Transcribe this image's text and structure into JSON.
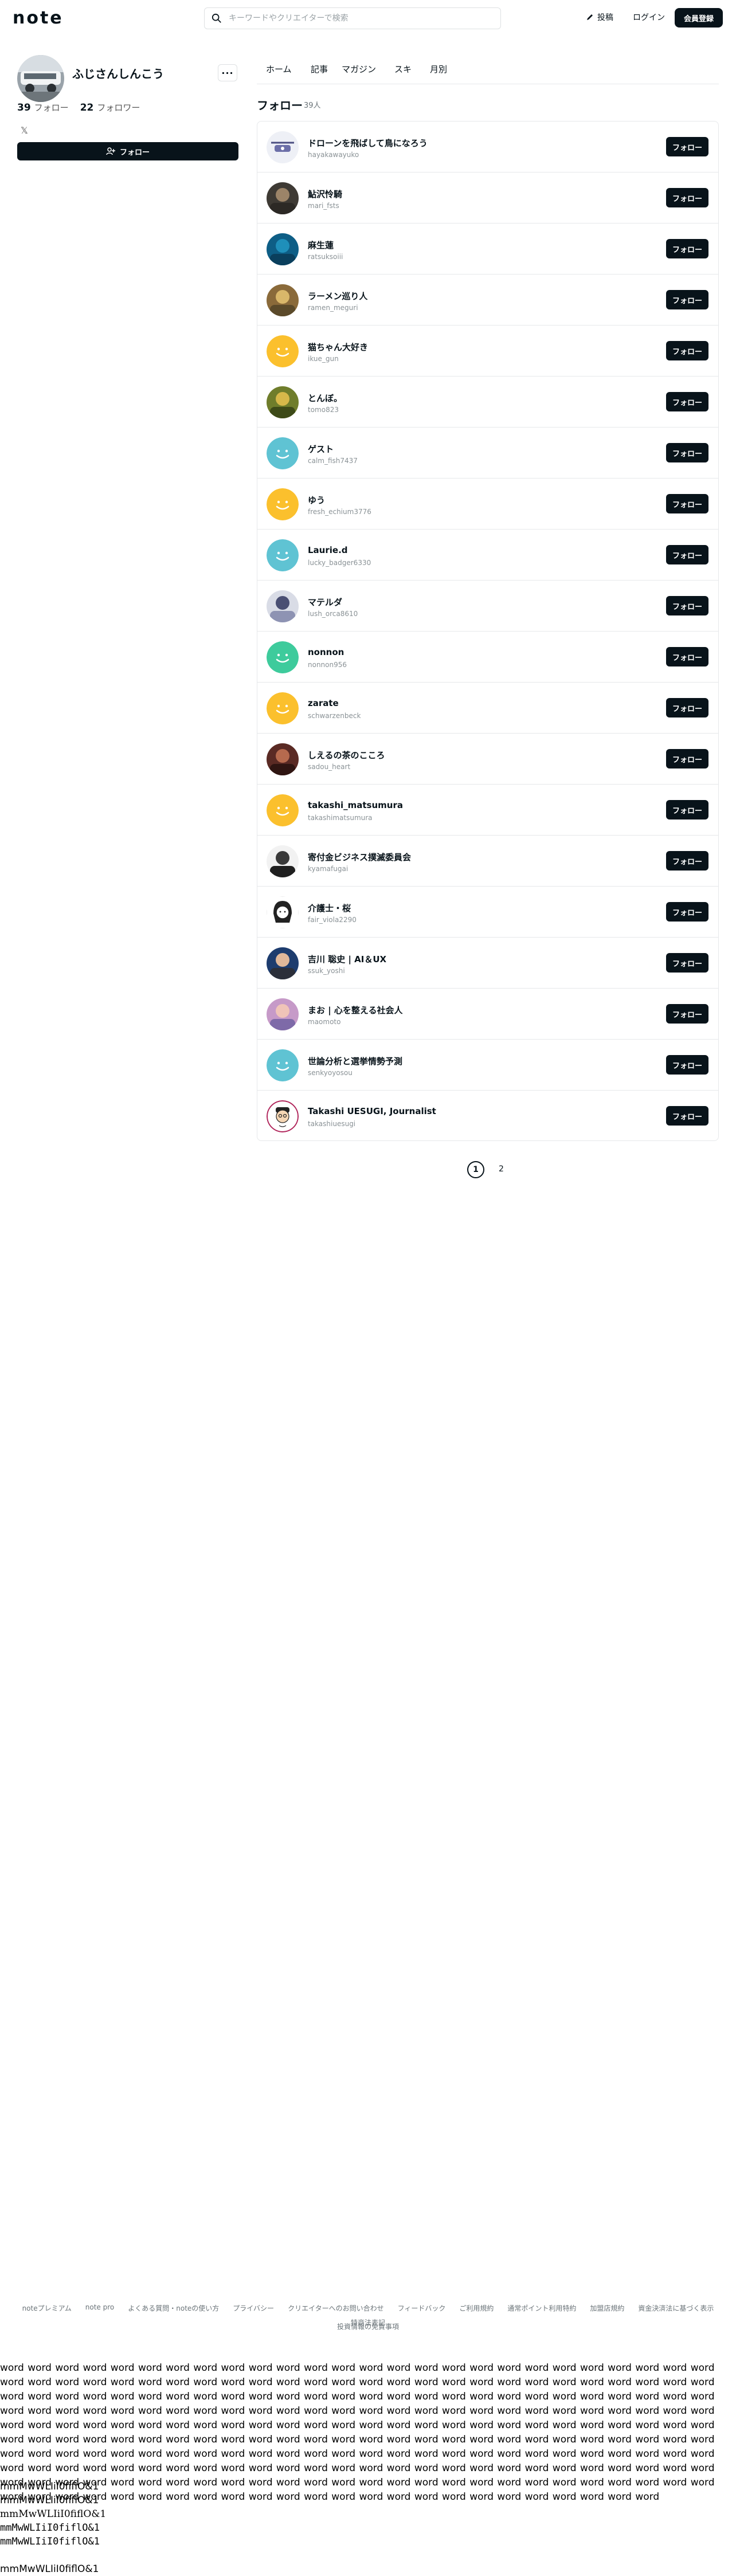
{
  "header": {
    "logo": "note",
    "search_placeholder": "キーワードやクリエイターで検索",
    "post_label": "投稿",
    "login_label": "ログイン",
    "signup_label": "会員登録"
  },
  "profile": {
    "name": "ふじさんしんこう",
    "follow_count": "39",
    "follow_label": "フォロー",
    "follower_count": "22",
    "follower_label": "フォロワー",
    "x_icon": "𝕏",
    "follow_button": "フォロー"
  },
  "tabs": [
    "ホーム",
    "記事",
    "マガジン",
    "スキ",
    "月別"
  ],
  "list": {
    "title": "フォロー",
    "count": "39人",
    "button_label": "フォロー",
    "users": [
      {
        "name": "ドローンを飛ばして鳥になろう",
        "id": "hayakawayuko",
        "avatar": "drone"
      },
      {
        "name": "鮎沢怜騎",
        "id": "mari_fsts",
        "avatar": "photo-dark"
      },
      {
        "name": "麻生蓮",
        "id": "ratsuksoiii",
        "avatar": "photo-ocean"
      },
      {
        "name": "ラーメン巡り人",
        "id": "ramen_meguri",
        "avatar": "photo-ramen"
      },
      {
        "name": "猫ちゃん大好き",
        "id": "ikue_gun",
        "avatar": "smile-yellow"
      },
      {
        "name": "とんぼ。",
        "id": "tomo823",
        "avatar": "photo-green"
      },
      {
        "name": "ゲスト",
        "id": "calm_fish7437",
        "avatar": "smile-blue"
      },
      {
        "name": "ゆう",
        "id": "fresh_echium3776",
        "avatar": "smile-yellow"
      },
      {
        "name": "Laurie.d",
        "id": "lucky_badger6330",
        "avatar": "smile-blue"
      },
      {
        "name": "マテルダ",
        "id": "lush_orca8610",
        "avatar": "photo-figure"
      },
      {
        "name": "nonnon",
        "id": "nonnon956",
        "avatar": "smile-green"
      },
      {
        "name": "zarate",
        "id": "schwarzenbeck",
        "avatar": "smile-yellow"
      },
      {
        "name": "しえるの茶のこころ",
        "id": "sadou_heart",
        "avatar": "photo-brown"
      },
      {
        "name": "takashi_matsumura",
        "id": "takashimatsumura",
        "avatar": "smile-yellow"
      },
      {
        "name": "寄付金ビジネス撲滅委員会",
        "id": "kyamafugai",
        "avatar": "photo-person"
      },
      {
        "name": "介護士・桜",
        "id": "fair_viola2290",
        "avatar": "illust-girl"
      },
      {
        "name": "吉川 聡史 | AI＆UX",
        "id": "ssuk_yoshi",
        "avatar": "photo-man"
      },
      {
        "name": "まお | 心を整える社会人",
        "id": "maomoto",
        "avatar": "photo-sky"
      },
      {
        "name": "世論分析と選挙情勢予測",
        "id": "senkyoyosou",
        "avatar": "smile-blue"
      },
      {
        "name": "Takashi UESUGI, Journalist",
        "id": "takashiuesugi",
        "avatar": "illust-man"
      }
    ]
  },
  "pagination": {
    "current": "1",
    "next": "2"
  },
  "footer": {
    "links": [
      "noteプレミアム",
      "note pro",
      "よくある質問・noteの使い方",
      "プライバシー",
      "クリエイターへのお問い合わせ",
      "フィードバック",
      "ご利用規約",
      "通常ポイント利用特約",
      "加盟店規約",
      "資金決済法に基づく表示",
      "特商法表記"
    ],
    "extra": "投資情報の免責事項"
  },
  "words_text": "word word word word word word word word word word word word word word word word word word word word word word word word word word word word word word word word word word word word word word word word word word word word word word word word word word word word word word word word word word word word word word word word word word word word word word word word word word word word word word word word word word word word word word word word word word word word word word word word word word word word word word word word word word word word word word word word word word word word word word word word word word word word word word word word word word word word word word word word word word word word word word word word word word word word word word word word word word word word word word word word word word word word word word word word word word word word word word word word word word word word word word word word word word word word word word word word word word word word word word word word word word word word word word word word word word word word word word word word word word word word word word word word word word word word word word word word word word word word word word word word word word word word word word word word word word word word word word word word word word",
  "mono_lines": [
    "mmMwWLIiI0fiflO&1",
    "mmMwWLIiI0fiflO&1",
    "mmMwWLIiI0fiflO&1",
    "mmMwWLIiI0fiflO&1",
    "mmMwWLIiI0fiflO&1",
    "",
    "mmMwWLIiI0fiflO&1"
  ]
}
